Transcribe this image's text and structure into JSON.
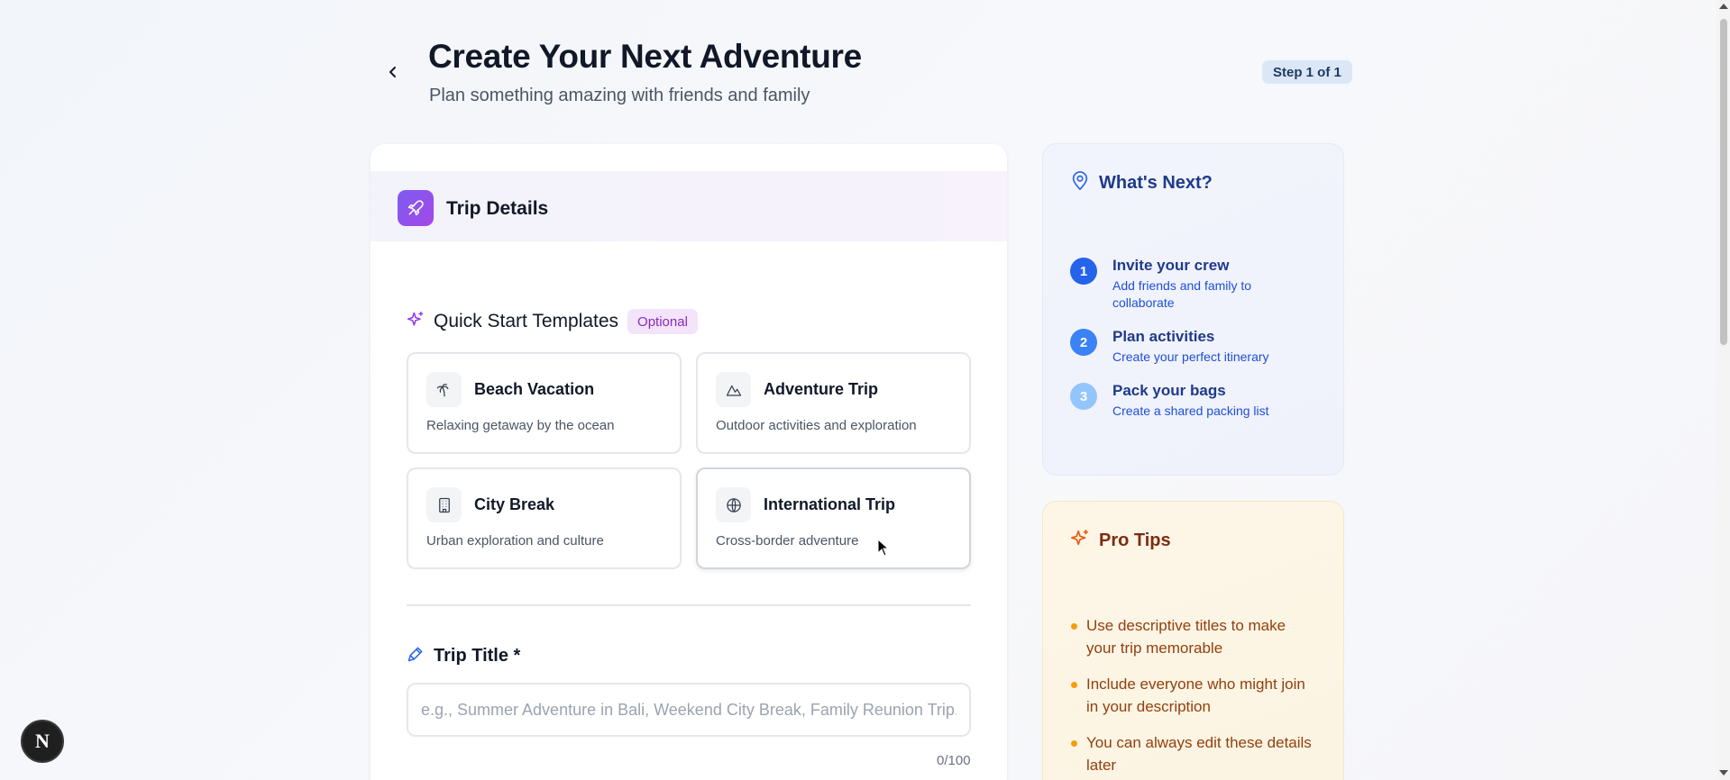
{
  "header": {
    "title": "Create Your Next Adventure",
    "subtitle": "Plan something amazing with friends and family",
    "step_badge": "Step 1 of 1",
    "back_icon": "chevron-left-icon"
  },
  "trip_details": {
    "title": "Trip Details",
    "icon": "plane-icon",
    "accent": "#8b5cf6"
  },
  "quick_start": {
    "title": "Quick Start Templates",
    "badge": "Optional",
    "icon": "sparkles-icon",
    "templates": [
      {
        "name": "Beach Vacation",
        "description": "Relaxing getaway by the ocean",
        "icon": "palm-tree-icon"
      },
      {
        "name": "Adventure Trip",
        "description": "Outdoor activities and exploration",
        "icon": "mountain-icon"
      },
      {
        "name": "City Break",
        "description": "Urban exploration and culture",
        "icon": "building-icon"
      },
      {
        "name": "International Trip",
        "description": "Cross-border adventure",
        "icon": "globe-icon"
      }
    ]
  },
  "trip_title": {
    "label": "Trip Title *",
    "icon": "pen-icon",
    "placeholder": "e.g., Summer Adventure in Bali, Weekend City Break, Family Reunion Trip...",
    "value": "",
    "char_count": "0/100"
  },
  "whats_next": {
    "title": "What's Next?",
    "icon": "map-pin-icon",
    "steps": [
      {
        "number": "1",
        "title": "Invite your crew",
        "description": "Add friends and family to collaborate",
        "color": "#2563eb"
      },
      {
        "number": "2",
        "title": "Plan activities",
        "description": "Create your perfect itinerary",
        "color": "#3b82f6"
      },
      {
        "number": "3",
        "title": "Pack your bags",
        "description": "Create a shared packing list",
        "color": "#93c5fd"
      }
    ]
  },
  "pro_tips": {
    "title": "Pro Tips",
    "icon": "sparkles-icon",
    "tips": [
      "Use descriptive titles to make your trip memorable",
      "Include everyone who might join in your description",
      "You can always edit these details later"
    ]
  },
  "dev_badge": {
    "label": "N"
  }
}
